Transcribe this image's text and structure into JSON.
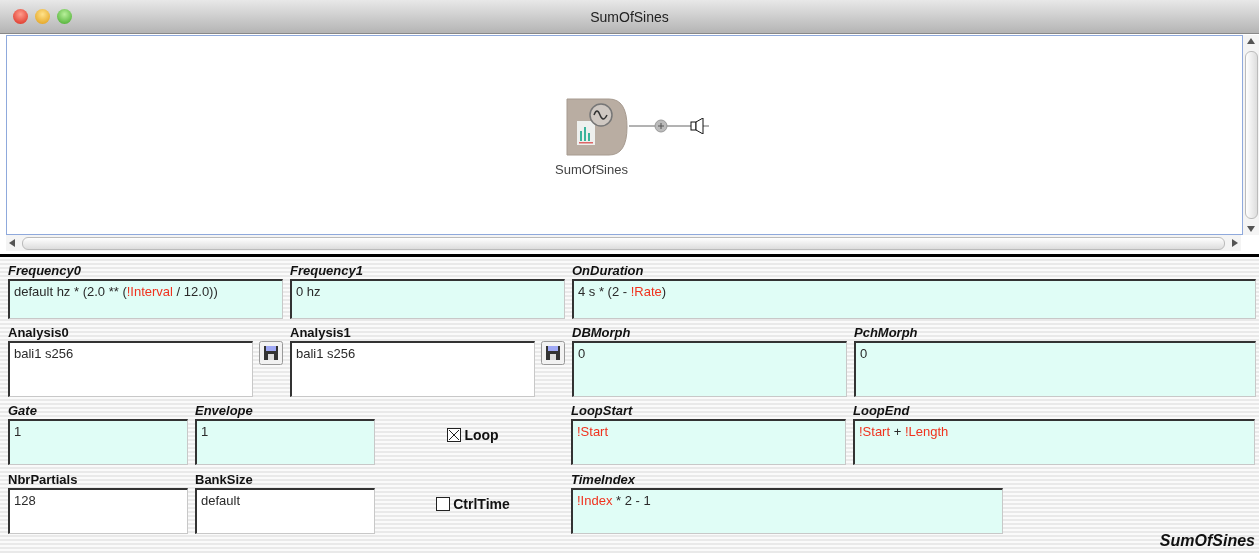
{
  "window": {
    "title": "SumOfSines"
  },
  "canvas": {
    "node": {
      "label": "SumOfSines"
    }
  },
  "parameters": [
    [
      {
        "kind": "expression",
        "label": "Frequency0",
        "value": [
          {
            "kind": "plain",
            "text": "default hz * (2.0 ** ("
          },
          {
            "kind": "variable",
            "text": "!Interval"
          },
          {
            "kind": "plain",
            "text": " / 12.0))"
          }
        ]
      },
      {
        "kind": "expression",
        "label": "Frequency1",
        "value": [
          {
            "kind": "plain",
            "text": "0 hz"
          }
        ]
      },
      {
        "kind": "expression",
        "label": "OnDuration",
        "value": [
          {
            "kind": "plain",
            "text": "4 s * (2 - "
          },
          {
            "kind": "variable",
            "text": "!Rate"
          },
          {
            "kind": "plain",
            "text": ")"
          }
        ]
      }
    ],
    [
      {
        "kind": "file",
        "label": "Analysis0",
        "value": [
          {
            "kind": "plain",
            "text": "bali1 s256"
          }
        ]
      },
      {
        "kind": "file",
        "label": "Analysis1",
        "value": [
          {
            "kind": "plain",
            "text": "bali1 s256"
          }
        ]
      },
      {
        "kind": "expression",
        "label": "DBMorph",
        "value": [
          {
            "kind": "plain",
            "text": "0"
          }
        ]
      },
      {
        "kind": "expression",
        "label": "PchMorph",
        "value": [
          {
            "kind": "plain",
            "text": "0"
          }
        ]
      }
    ],
    [
      {
        "kind": "expression",
        "label": "Gate",
        "value": [
          {
            "kind": "plain",
            "text": "1"
          }
        ]
      },
      {
        "kind": "expression",
        "label": "Envelope",
        "value": [
          {
            "kind": "plain",
            "text": "1"
          }
        ]
      },
      {
        "kind": "checkbox",
        "label": "Loop",
        "checked": true
      },
      {
        "kind": "expression",
        "label": "LoopStart",
        "value": [
          {
            "kind": "variable",
            "text": "!Start"
          }
        ]
      },
      {
        "kind": "expression",
        "label": "LoopEnd",
        "value": [
          {
            "kind": "variable",
            "text": "!Start"
          },
          {
            "kind": "plain",
            "text": " + "
          },
          {
            "kind": "variable",
            "text": "!Length"
          }
        ]
      }
    ],
    [
      {
        "kind": "text",
        "label": "NbrPartials",
        "value": [
          {
            "kind": "plain",
            "text": "128"
          }
        ]
      },
      {
        "kind": "text",
        "label": "BankSize",
        "value": [
          {
            "kind": "plain",
            "text": "default"
          }
        ]
      },
      {
        "kind": "checkbox",
        "label": "CtrlTime",
        "checked": false
      },
      {
        "kind": "expression",
        "label": "TimeIndex",
        "value": [
          {
            "kind": "variable",
            "text": "!Index"
          },
          {
            "kind": "plain",
            "text": " * 2 - 1"
          }
        ]
      }
    ]
  ],
  "footer": "SumOfSines"
}
